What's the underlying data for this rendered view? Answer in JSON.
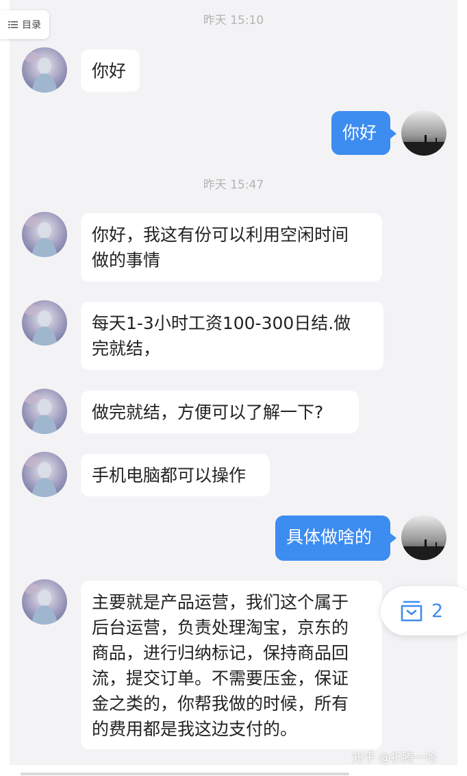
{
  "toc": {
    "label": "目录"
  },
  "timestamps": {
    "first": "昨天 15:10",
    "second": "昨天 15:47"
  },
  "messages": [
    {
      "side": "in",
      "text": "你好"
    },
    {
      "side": "out",
      "text": "你好"
    },
    {
      "side": "in",
      "line1": "你好，我这有份可以利用空闲时间",
      "line2": "做的事情"
    },
    {
      "side": "in",
      "line1": "每天1-3小时工资100-300日结.做",
      "line2": "完就结，"
    },
    {
      "side": "in",
      "text": "做完就结，方便可以了解一下?"
    },
    {
      "side": "in",
      "text": "手机电脑都可以操作"
    },
    {
      "side": "out",
      "text": "具体做啥的"
    },
    {
      "side": "in",
      "lines": [
        "主要就是产品运营，我们这个属于",
        "后台运营，负责处理淘宝，京东的",
        "商品，进行归纳标记，保持商品回",
        "流，提交订单。不需要压金，保证",
        "金之类的，你帮我做的时候，所有",
        "的费用都是我这边支付的。"
      ]
    }
  ],
  "float_button": {
    "icon": "collection-icon",
    "count": "2"
  },
  "watermark": "知乎 @折腾一哈",
  "colors": {
    "accent": "#3d8cf0",
    "background": "#f3f3f5",
    "bubble_in": "#ffffff"
  }
}
